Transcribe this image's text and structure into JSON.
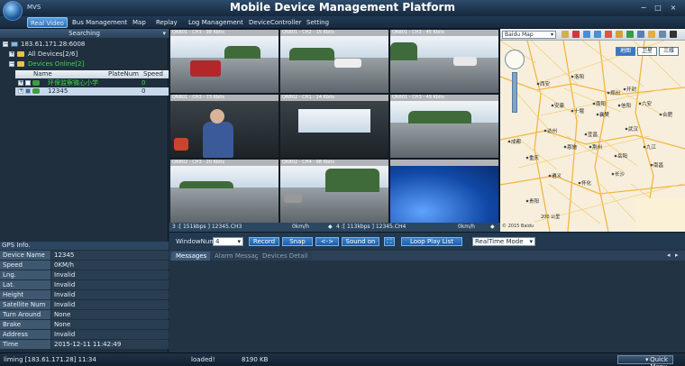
{
  "window": {
    "app_short": "MVS",
    "title": "Mobile Device Management Platform",
    "minimize": "−",
    "maximize": "□",
    "close": "×"
  },
  "menu": [
    {
      "label": "Real Video",
      "active": true
    },
    {
      "label": "Bus Management",
      "active": false
    },
    {
      "label": "Map",
      "active": false
    },
    {
      "label": "Replay",
      "active": false
    },
    {
      "label": "Log Management",
      "active": false
    },
    {
      "label": "DeviceController",
      "active": false
    },
    {
      "label": "Setting",
      "active": false
    }
  ],
  "tree": {
    "search_label": "Searching",
    "server": "183.61.171.28:6008",
    "all_devices": "All Devices[2/6]",
    "devices_online": "Devices Online[2]",
    "columns": [
      "Name",
      "PlateNum",
      "Speed"
    ],
    "devices": [
      {
        "name": "环保监察微心小学",
        "speed": "0"
      },
      {
        "name": "12345",
        "speed": "0"
      }
    ]
  },
  "gps": {
    "title": "GPS Info.",
    "rows": [
      {
        "key": "Device Name",
        "value": "12345"
      },
      {
        "key": "Speed",
        "value": "0KM/h"
      },
      {
        "key": "Lng.",
        "value": "Invalid"
      },
      {
        "key": "Lat.",
        "value": "Invalid"
      },
      {
        "key": "Height",
        "value": "Invalid"
      },
      {
        "key": "Satellite Num",
        "value": "Invalid"
      },
      {
        "key": "Turn Around",
        "value": "None"
      },
      {
        "key": "Brake",
        "value": "None"
      },
      {
        "key": "Address",
        "value": "Invalid"
      },
      {
        "key": "Time",
        "value": "2015-12-11 11:42:49"
      }
    ]
  },
  "videos": [
    {
      "cap": "QN801 - CH3 - 98 Kbits"
    },
    {
      "cap": "QN801 - CH2 - 15 Kbits"
    },
    {
      "cap": "QN801 - CH3 - 45 Kbits"
    },
    {
      "cap": "QN801 - CH3 - 73 Kbits"
    },
    {
      "cap": "QN802 - CH1 - 14 Kbits"
    },
    {
      "cap": "QN801 - CH3 - 49 Kbits"
    },
    {
      "cap": "QN802 - CH3 - 20 Kbits"
    },
    {
      "cap": "QN802 - CH4 - 98 Kbits"
    },
    {
      "cap": ""
    }
  ],
  "video_status": {
    "left": "3 :[ 151kbps ] 12345.CH3",
    "left_speed": "0km/h",
    "right": "4 :[ 113kbps ] 12345.CH4",
    "right_speed": "0km/h"
  },
  "map": {
    "provider": "Baidu Map",
    "layers": [
      "地图",
      "卫星",
      "三维"
    ],
    "cities": [
      "西安",
      "郑州",
      "开封",
      "武汉",
      "合肥",
      "长沙",
      "南昌",
      "重庆",
      "成都",
      "贵阳",
      "宜昌",
      "襄樊",
      "信阳",
      "南阳",
      "安康",
      "达州",
      "遵义",
      "怀化",
      "岳阳",
      "九江",
      "荆州",
      "洛阳",
      "十堰",
      "恩施",
      "六安"
    ],
    "scale": "200 公里",
    "copyright": "© 2015 Baidu"
  },
  "controls": {
    "window_num_label": "WindowNum",
    "window_num": "4",
    "record": "Record",
    "snap": "Snap",
    "swap": "<->",
    "sound_on": "Sound on",
    "loop_play": "Loop Play List",
    "mode": "RealTime Mode"
  },
  "messages": {
    "tabs": [
      "Messages",
      "Alarm Message",
      "Devices Detail"
    ]
  },
  "status": {
    "user": "liming [183.61.171.28] 11:34",
    "loaded": "loaded!",
    "memory": "8190 KB",
    "quick_menu": "Quick Menu"
  },
  "colors": {
    "accent": "#2c6db5",
    "online": "#3cdc3c"
  }
}
